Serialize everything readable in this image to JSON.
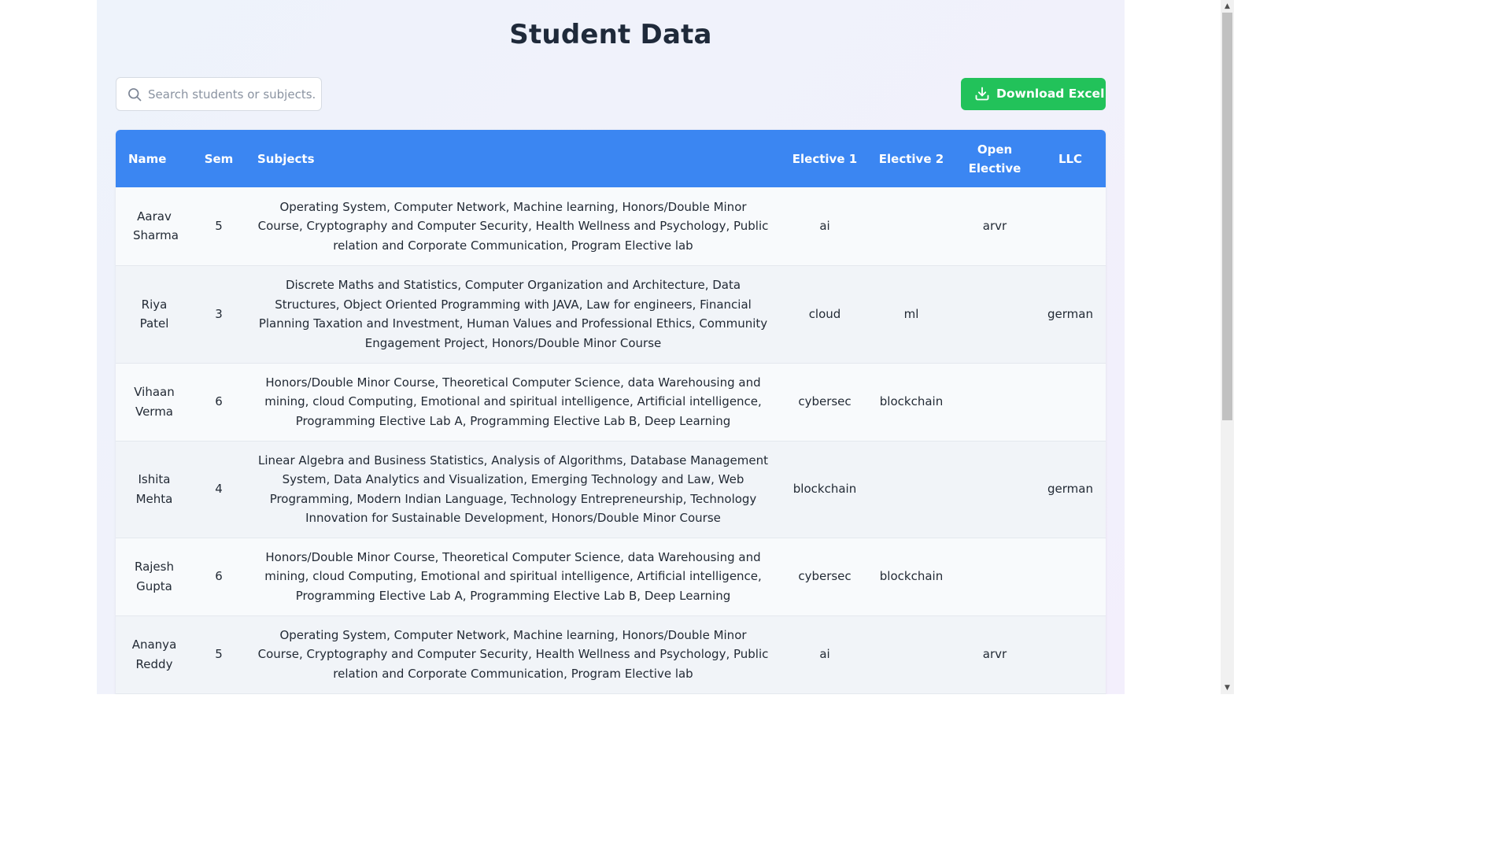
{
  "page": {
    "title": "Student Data"
  },
  "search": {
    "placeholder": "Search students or subjects..",
    "value": "",
    "icon": "search-icon"
  },
  "toolbar": {
    "download_label": "Download Excel",
    "download_icon": "download-icon",
    "download_color": "#22c25a"
  },
  "table": {
    "header_color": "#3b86f2",
    "columns": {
      "name": "Name",
      "sem": "Sem",
      "subjects": "Subjects",
      "elective1": "Elective 1",
      "elective2": "Elective 2",
      "open_elective": "Open Elective",
      "llc": "LLC"
    },
    "rows": [
      {
        "name": "Aarav Sharma",
        "sem": "5",
        "subjects": "Operating System, Computer Network, Machine learning, Honors/Double Minor Course, Cryptography and Computer Security, Health Wellness and Psychology, Public relation and Corporate Communication, Program Elective lab",
        "elective1": "ai",
        "elective2": "",
        "open_elective": "arvr",
        "llc": ""
      },
      {
        "name": "Riya Patel",
        "sem": "3",
        "subjects": "Discrete Maths and Statistics, Computer Organization and Architecture, Data Structures, Object Oriented Programming with JAVA, Law for engineers, Financial Planning Taxation and Investment, Human Values and Professional Ethics, Community Engagement Project, Honors/Double Minor Course",
        "elective1": "cloud",
        "elective2": "ml",
        "open_elective": "",
        "llc": "german"
      },
      {
        "name": "Vihaan Verma",
        "sem": "6",
        "subjects": "Honors/Double Minor Course, Theoretical Computer Science, data Warehousing and mining, cloud Computing, Emotional and spiritual intelligence, Artificial intelligence, Programming Elective Lab A, Programming Elective Lab B, Deep Learning",
        "elective1": "cybersec",
        "elective2": "blockchain",
        "open_elective": "",
        "llc": ""
      },
      {
        "name": "Ishita Mehta",
        "sem": "4",
        "subjects": "Linear Algebra and Business Statistics, Analysis of Algorithms, Database Management System, Data Analytics and Visualization, Emerging Technology and Law, Web Programming, Modern Indian Language, Technology Entrepreneurship, Technology Innovation for Sustainable Development, Honors/Double Minor Course",
        "elective1": "blockchain",
        "elective2": "",
        "open_elective": "",
        "llc": "german"
      },
      {
        "name": "Rajesh Gupta",
        "sem": "6",
        "subjects": "Honors/Double Minor Course, Theoretical Computer Science, data Warehousing and mining, cloud Computing, Emotional and spiritual intelligence, Artificial intelligence, Programming Elective Lab A, Programming Elective Lab B, Deep Learning",
        "elective1": "cybersec",
        "elective2": "blockchain",
        "open_elective": "",
        "llc": ""
      },
      {
        "name": "Ananya Reddy",
        "sem": "5",
        "subjects": "Operating System, Computer Network, Machine learning, Honors/Double Minor Course, Cryptography and Computer Security, Health Wellness and Psychology, Public relation and Corporate Communication, Program Elective lab",
        "elective1": "ai",
        "elective2": "",
        "open_elective": "arvr",
        "llc": ""
      }
    ]
  }
}
